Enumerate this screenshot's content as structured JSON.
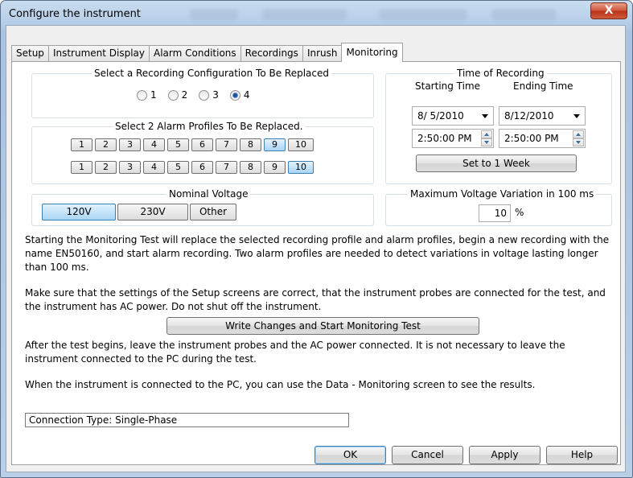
{
  "window": {
    "title": "Configure the instrument",
    "close_glyph": "X"
  },
  "tabs": [
    {
      "label": "Setup",
      "active": false
    },
    {
      "label": "Instrument Display",
      "active": false
    },
    {
      "label": "Alarm Conditions",
      "active": false
    },
    {
      "label": "Recordings",
      "active": false
    },
    {
      "label": "Inrush",
      "active": false
    },
    {
      "label": "Monitoring",
      "active": true
    }
  ],
  "recording_config": {
    "title": "Select a Recording Configuration To Be Replaced",
    "options": [
      "1",
      "2",
      "3",
      "4"
    ],
    "selected": "4"
  },
  "alarm_profiles": {
    "title": "Select 2 Alarm Profiles To Be Replaced.",
    "row1": [
      "1",
      "2",
      "3",
      "4",
      "5",
      "6",
      "7",
      "8",
      "9",
      "10"
    ],
    "row1_selected": "9",
    "row2": [
      "1",
      "2",
      "3",
      "4",
      "5",
      "6",
      "7",
      "8",
      "9",
      "10"
    ],
    "row2_selected": "10"
  },
  "time_of_recording": {
    "title": "Time of Recording",
    "start_label": "Starting Time",
    "end_label": "Ending Time",
    "start_date": "8/ 5/2010",
    "end_date": "8/12/2010",
    "start_time": "2:50:00 PM",
    "end_time": "2:50:00 PM",
    "set_week_label": "Set to 1 Week"
  },
  "nominal_voltage": {
    "title": "Nominal Voltage",
    "options": [
      "120V",
      "230V",
      "Other"
    ],
    "selected": "120V"
  },
  "max_variation": {
    "title": "Maximum Voltage Variation in 100 ms",
    "value": "10",
    "unit": "%"
  },
  "text": {
    "para1": "Starting the Monitoring Test will replace the selected recording profile and alarm profiles, begin a new recording with the name EN50160, and start alarm recording. Two alarm profiles are needed to detect variations in voltage lasting longer than 100 ms.",
    "para2": "Make sure that the settings of the Setup screens are correct, that the instrument probes are connected for the test, and the instrument has AC power. Do not shut off the instrument.",
    "write_button": "Write Changes and Start Monitoring Test",
    "para3": "After the test begins, leave the instrument probes and the AC power connected. It is not necessary to leave the instrument connected to the PC during the test.",
    "para4": "When the instrument is connected to the PC, you can use the Data - Monitoring screen to see the results.",
    "connection": "Connection Type: Single-Phase"
  },
  "dialog_buttons": {
    "ok": "OK",
    "cancel": "Cancel",
    "apply": "Apply",
    "help": "Help"
  }
}
